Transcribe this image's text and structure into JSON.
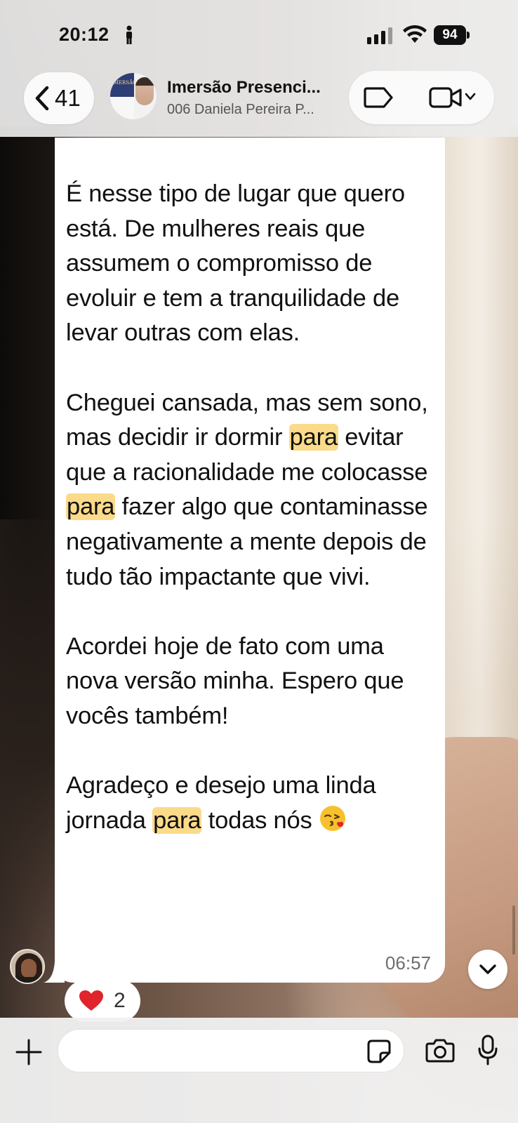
{
  "status_bar": {
    "time": "20:12",
    "battery": "94"
  },
  "header": {
    "back_count": "41",
    "title": "Imersão Presenci...",
    "subtitle": "006 Daniela Pereira P...",
    "avatar_text": "IMERSÃO"
  },
  "message": {
    "paragraphs": [
      [
        "É nesse tipo de lugar que quero está. De mulheres reais que assumem o compromisso de evoluir e tem a tranquilidade de levar outras com elas."
      ],
      [
        "Cheguei cansada, mas sem sono, mas decidir ir dormir ",
        "para",
        " evitar que a racionalidade me colocasse ",
        "para",
        " fazer algo que contaminasse negativamente a mente depois de tudo tão impactante que vivi."
      ],
      [
        "Acordei hoje de fato com uma nova versão minha. Espero que vocês também!"
      ],
      [
        "Agradeço e desejo uma linda jornada ",
        "para",
        " todas nós "
      ]
    ],
    "time": "06:57",
    "highlight_color": "#fbdb8a"
  },
  "reaction": {
    "emoji": "heart",
    "count": "2"
  },
  "composer": {
    "value": "",
    "placeholder": ""
  },
  "colors": {
    "header_bg": "#ececec",
    "bubble_bg": "#ffffff",
    "time_text": "#6e6e6e",
    "heart": "#e0242c"
  }
}
